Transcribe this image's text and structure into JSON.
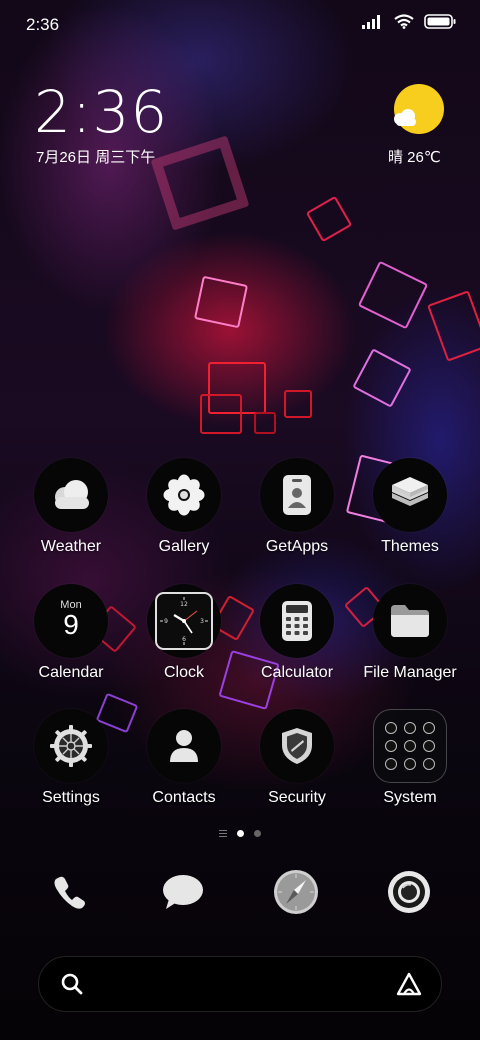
{
  "status_bar": {
    "time": "2:36"
  },
  "lockclock": {
    "time": "2:36",
    "date": "7月26日 周三下午"
  },
  "weather_widget": {
    "text": "晴 26℃"
  },
  "apps": [
    {
      "label": "Weather",
      "icon": "weather-icon"
    },
    {
      "label": "Gallery",
      "icon": "flower-icon"
    },
    {
      "label": "GetApps",
      "icon": "getapps-icon"
    },
    {
      "label": "Themes",
      "icon": "layers-icon"
    },
    {
      "label": "Calendar",
      "icon": "calendar-icon",
      "day_name": "Mon",
      "day_number": "9"
    },
    {
      "label": "Clock",
      "icon": "clock-icon"
    },
    {
      "label": "Calculator",
      "icon": "calculator-icon"
    },
    {
      "label": "File Manager",
      "icon": "folder-icon"
    },
    {
      "label": "Settings",
      "icon": "gear-icon"
    },
    {
      "label": "Contacts",
      "icon": "person-icon"
    },
    {
      "label": "Security",
      "icon": "shield-icon"
    },
    {
      "label": "System",
      "icon": "app-folder-icon"
    }
  ],
  "page_indicator": {
    "pages": 2,
    "current": 1
  },
  "dock": [
    {
      "icon": "phone-icon"
    },
    {
      "icon": "messages-icon"
    },
    {
      "icon": "browser-compass-icon"
    },
    {
      "icon": "camera-icon"
    }
  ],
  "colors": {
    "accent_sun": "#F7CE1E",
    "background": "#000000",
    "icon_fg": "#E8E8E8"
  }
}
